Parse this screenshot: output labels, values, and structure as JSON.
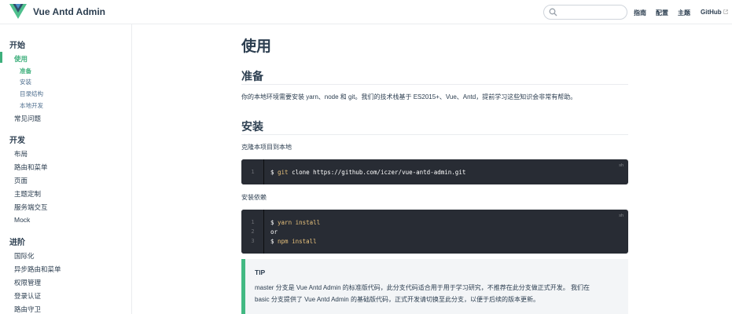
{
  "header": {
    "site_name": "Vue Antd Admin",
    "search_placeholder": "",
    "nav": [
      "指南",
      "配置",
      "主题",
      "GitHub"
    ],
    "accent": "#3eaf7c"
  },
  "sidebar": {
    "groups": [
      {
        "title": "开始",
        "items": [
          {
            "label": "使用",
            "active": true,
            "children": [
              "准备",
              "安装",
              "目录结构",
              "本地开发"
            ]
          },
          {
            "label": "常见问题"
          }
        ]
      },
      {
        "title": "开发",
        "items": [
          {
            "label": "布局"
          },
          {
            "label": "路由和菜单"
          },
          {
            "label": "页面"
          },
          {
            "label": "主题定制"
          },
          {
            "label": "服务端交互"
          },
          {
            "label": "Mock"
          }
        ]
      },
      {
        "title": "进阶",
        "items": [
          {
            "label": "国际化"
          },
          {
            "label": "异步路由和菜单"
          },
          {
            "label": "权限管理"
          },
          {
            "label": "登录认证"
          },
          {
            "label": "路由守卫"
          }
        ]
      }
    ]
  },
  "content": {
    "title": "使用",
    "sections": [
      {
        "heading": "准备",
        "text": "你的本地环境需要安装 yarn、node 和 git。我们的技术栈基于 ES2015+、Vue、Antd，提前学习这些知识会非常有帮助。"
      },
      {
        "heading": "安装",
        "clone_label": "克隆本项目到本地",
        "clone_code": {
          "lang": "sh",
          "line_numbers": [
            "1"
          ],
          "prompt": "$ ",
          "cmd": "git",
          "rest": " clone https://github.com/iczer/vue-antd-admin.git"
        },
        "deps_label": "安装依赖",
        "deps_code": {
          "lang": "sh",
          "line_numbers": [
            "1",
            "2",
            "3"
          ],
          "line1_prompt": "$ ",
          "line1_cmd": "yarn install",
          "line2": "or",
          "line3_prompt": "$ ",
          "line3_cmd": "npm install"
        }
      }
    ],
    "tip": {
      "title": "TIP",
      "line1": "master 分支是 Vue Antd Admin 的标准版代码，此分支代码适合用于用于学习研究，不推荐在此分支做正式开发。 我们在",
      "line2": "basic 分支提供了 Vue Antd Admin 的基础版代码，正式开发请切换至此分支，以便于后续的版本更新。"
    }
  }
}
